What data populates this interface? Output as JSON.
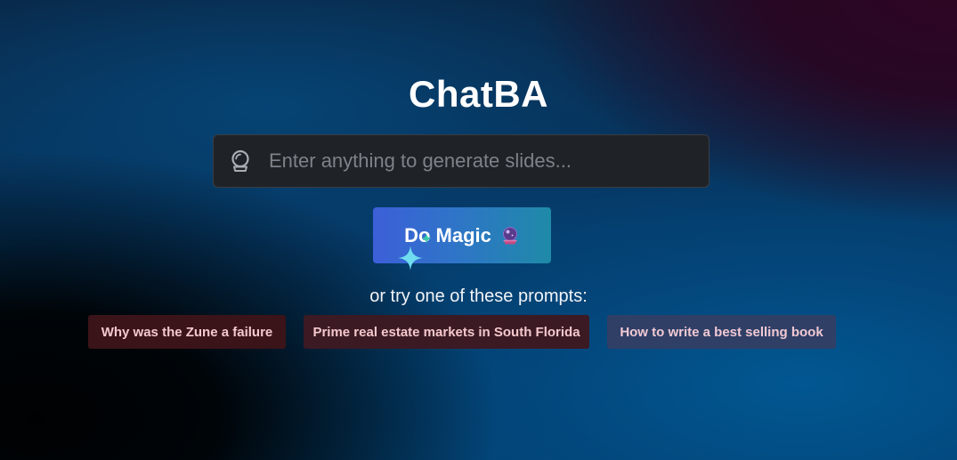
{
  "app": {
    "title": "ChatBA"
  },
  "search": {
    "placeholder": "Enter anything to generate slides...",
    "value": "",
    "icon": "crystal-ball-outline-icon"
  },
  "magic_button": {
    "label": "Do Magic",
    "icon": "crystal-ball-icon"
  },
  "prompts": {
    "heading": "or try one of these prompts:",
    "items": [
      {
        "label": "Why was the Zune a failure"
      },
      {
        "label": "Prime real estate markets in South Florida"
      },
      {
        "label": "How to write a best selling book"
      }
    ]
  },
  "colors": {
    "button_gradient_start": "#3c5fd8",
    "button_gradient_end": "#1f8aa8",
    "input_background": "#1f2226",
    "chip_dark_red": "#3a1419",
    "chip_blue": "#2f3f66",
    "sparkle": "#5fd6e8"
  }
}
